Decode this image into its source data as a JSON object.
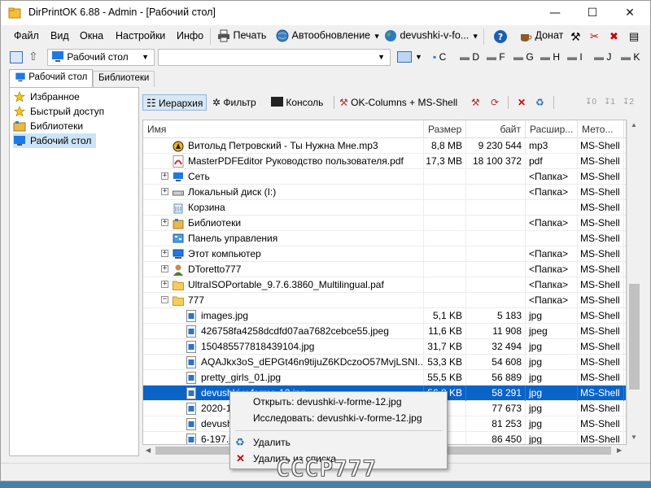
{
  "window": {
    "title": "DirPrintOK 6.88 - Admin - [Рабочий стол]"
  },
  "controls": {
    "minimize": "—",
    "maximize": "☐",
    "close": "✕"
  },
  "menu": [
    "Файл",
    "Вид",
    "Окна",
    "Настройки",
    "Инфо"
  ],
  "toolbar": {
    "print": "Печать",
    "autoupdate": "Автообновление",
    "site": "devushki-v-fo...",
    "donate": "Донат"
  },
  "pathbar": {
    "location": "Рабочий стол",
    "drives": [
      "C",
      "D",
      "F",
      "G",
      "H",
      "I",
      "J",
      "K"
    ]
  },
  "tabs": [
    "Рабочий стол",
    "Библиотеки"
  ],
  "tree": [
    "Избранное",
    "Быстрый доступ",
    "Библиотеки",
    "Рабочий стол"
  ],
  "viewbar": {
    "hierarchy": "Иерархия",
    "filter": "Фильтр",
    "console": "Консоль",
    "columns": "OK-Columns + MS-Shell"
  },
  "columns": [
    "Имя",
    "Размер",
    "байт",
    "Расшир...",
    "Мето..."
  ],
  "rows": [
    {
      "level": 1,
      "exp": "",
      "icon": "mp3-icon",
      "name": "Витольд Петровский - Ты Нужна Мне.mp3",
      "size": "8,8 MB",
      "bytes": "9 230 544",
      "ext": "mp3",
      "method": "MS-Shell",
      "last": "C"
    },
    {
      "level": 1,
      "exp": "",
      "icon": "pdf-icon",
      "name": "MasterPDFEditor Руководство пользователя.pdf",
      "size": "17,3 MB",
      "bytes": "18 100 372",
      "ext": "pdf",
      "method": "MS-Shell",
      "last": "C"
    },
    {
      "level": 1,
      "exp": "+",
      "icon": "network-icon",
      "name": "Сеть",
      "size": "",
      "bytes": "",
      "ext": "<Папка>",
      "method": "MS-Shell",
      "last": "C"
    },
    {
      "level": 1,
      "exp": "+",
      "icon": "drive-icon",
      "name": "Локальный диск (I:)",
      "size": "",
      "bytes": "",
      "ext": "<Папка>",
      "method": "MS-Shell",
      "last": "I"
    },
    {
      "level": 1,
      "exp": "",
      "icon": "recycle-bin-icon",
      "name": "Корзина",
      "size": "",
      "bytes": "",
      "ext": "",
      "method": "MS-Shell",
      "last": "C"
    },
    {
      "level": 1,
      "exp": "+",
      "icon": "libraries-icon",
      "name": "Библиотеки",
      "size": "",
      "bytes": "",
      "ext": "<Папка>",
      "method": "MS-Shell",
      "last": "C"
    },
    {
      "level": 1,
      "exp": "",
      "icon": "control-panel-icon",
      "name": "Панель управления",
      "size": "",
      "bytes": "",
      "ext": "",
      "method": "MS-Shell",
      "last": "C"
    },
    {
      "level": 1,
      "exp": "+",
      "icon": "computer-icon",
      "name": "Этот компьютер",
      "size": "",
      "bytes": "",
      "ext": "<Папка>",
      "method": "MS-Shell",
      "last": "C"
    },
    {
      "level": 1,
      "exp": "+",
      "icon": "user-icon",
      "name": "DToretto777",
      "size": "",
      "bytes": "",
      "ext": "<Папка>",
      "method": "MS-Shell",
      "last": "C"
    },
    {
      "level": 1,
      "exp": "+",
      "icon": "folder-icon",
      "name": "UltraISOPortable_9.7.6.3860_Multilingual.paf",
      "size": "",
      "bytes": "",
      "ext": "<Папка>",
      "method": "MS-Shell",
      "last": "C"
    },
    {
      "level": 1,
      "exp": "−",
      "icon": "folder-icon",
      "name": "777",
      "size": "",
      "bytes": "",
      "ext": "<Папка>",
      "method": "MS-Shell",
      "last": "C"
    },
    {
      "level": 2,
      "exp": "",
      "icon": "image-icon",
      "name": "images.jpg",
      "size": "5,1 KB",
      "bytes": "5 183",
      "ext": "jpg",
      "method": "MS-Shell",
      "last": "C"
    },
    {
      "level": 2,
      "exp": "",
      "icon": "image-icon",
      "name": "426758fa4258dcdfd07aa7682cebce55.jpeg",
      "size": "11,6 KB",
      "bytes": "11 908",
      "ext": "jpeg",
      "method": "MS-Shell",
      "last": "C"
    },
    {
      "level": 2,
      "exp": "",
      "icon": "image-icon",
      "name": "150485577818439104.jpg",
      "size": "31,7 KB",
      "bytes": "32 494",
      "ext": "jpg",
      "method": "MS-Shell",
      "last": "C"
    },
    {
      "level": 2,
      "exp": "",
      "icon": "image-icon",
      "name": "AQAJkx3oS_dEPGt46n9tijuZ6KDczoO57MvjLSNI...",
      "size": "53,3 KB",
      "bytes": "54 608",
      "ext": "jpg",
      "method": "MS-Shell",
      "last": "C"
    },
    {
      "level": 2,
      "exp": "",
      "icon": "image-icon",
      "name": "pretty_girls_01.jpg",
      "size": "55,5 KB",
      "bytes": "56 889",
      "ext": "jpg",
      "method": "MS-Shell",
      "last": "C"
    },
    {
      "level": 2,
      "exp": "",
      "icon": "image-icon",
      "name": "devushki-v-forme-12.jpg",
      "size": "56,8 KB",
      "bytes": "58 291",
      "ext": "jpg",
      "method": "MS-Shell",
      "last": "C",
      "selected": true
    },
    {
      "level": 2,
      "exp": "",
      "icon": "image-icon",
      "name": "2020-1...",
      "size": "",
      "bytes": "77 673",
      "ext": "jpg",
      "method": "MS-Shell",
      "last": "C"
    },
    {
      "level": 2,
      "exp": "",
      "icon": "image-icon",
      "name": "devush...",
      "size": "",
      "bytes": "81 253",
      "ext": "jpg",
      "method": "MS-Shell",
      "last": "C"
    },
    {
      "level": 2,
      "exp": "",
      "icon": "image-icon",
      "name": "6-197.j...",
      "size": "",
      "bytes": "86 450",
      "ext": "jpg",
      "method": "MS-Shell",
      "last": "C"
    }
  ],
  "context_menu": {
    "open": "Открыть: devushki-v-forme-12.jpg",
    "explore": "Исследовать: devushki-v-forme-12.jpg",
    "delete": "Удалить",
    "remove": "Удалить из списка"
  },
  "watermark": "СССР777"
}
